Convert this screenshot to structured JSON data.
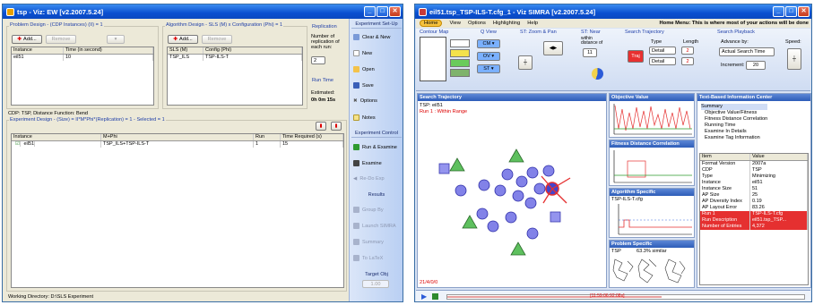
{
  "left_window": {
    "title": "tsp - Viz: EW [v2.2007.5.24]",
    "problem_design": {
      "title": "Problem Design - (CDP Instances) (II) = 1",
      "add_label": "Add...",
      "remove_label": "Remove",
      "columns": [
        "Instance",
        "Time (in second)"
      ],
      "rows": [
        [
          "eil51",
          "10"
        ]
      ],
      "cdp_text": "CDP: TSP, Distance Function: Bend"
    },
    "algorithm_design": {
      "title": "Algorithm Design - SLS (M) x Configuration (Phi) = 1",
      "add_label": "Add...",
      "remove_label": "Remove",
      "columns": [
        "SLS (M)",
        "Config (Phi)"
      ],
      "rows": [
        [
          "TSP_ILS",
          "TSP-ILS-T"
        ]
      ]
    },
    "replication": {
      "title": "Replication",
      "label": "Number of replication of each run:",
      "value": "2"
    },
    "run_time": {
      "title": "Run Time",
      "label": "Estimated:",
      "value": "0h 0m 15s"
    },
    "experiment_design": {
      "title": "Experiment Design - (Size) = II*M*Phi*(Replication) = 1 - Selected = 1",
      "columns": [
        "Instance",
        "M+Phi",
        "Run",
        "Time Required (s)"
      ],
      "rows": [
        [
          "eil51",
          "TSP_ILS+TSP-ILS-T",
          "1",
          "15"
        ]
      ]
    },
    "working_directory": "Working Directory:  D:\\SLS Experiment",
    "sidebar": {
      "setup_title": "Experiment Set-Up",
      "setup_items": [
        "Clear & New",
        "New",
        "Open",
        "Save",
        "Options",
        "Notes"
      ],
      "control_title": "Experiment Control",
      "control_items": [
        "Run & Examine",
        "Examine",
        "Re-Do Exp"
      ],
      "results_title": "Results",
      "results_items": [
        "Group By",
        "Launch SIMRA",
        "Summary",
        "To LaTeX"
      ],
      "target_title": "Target Obj",
      "target_value": "1.00"
    }
  },
  "right_window": {
    "title": "eil51.tsp_TSP-ILS-T.cfg_1 - Viz SIMRA [v2.2007.5.24]",
    "menu": [
      "Home",
      "View",
      "Options",
      "Highlighting",
      "Help"
    ],
    "home_menu_text": "Home Menu: This is where most of your actions will be done",
    "toolbar": {
      "contour_map": "Contour Map",
      "q_view": "Q View",
      "zoom_pan": "ST: Zoom & Pan",
      "st_near": "ST: Near",
      "near_label": "within distance of",
      "near_value": "11",
      "search_trajectory": "Search Trajectory",
      "type_label": "Type",
      "length_label": "Length",
      "type_value": "Detail",
      "length_value": "2",
      "search_playback": "Search Playback",
      "advance_by": "Advance by:",
      "speed_label": "Speed:",
      "advance_value": "Actual Search Time",
      "increment_label": "Increment:",
      "increment_value": "20"
    },
    "search_trajectory_panel": {
      "title": "Search Trajectory",
      "tsp_label": "TSP: eil51",
      "run_label": "Run 1 : Within Range",
      "time_label": "21/4/0/0"
    },
    "objective_panel": {
      "title": "Objective Value"
    },
    "fdc_panel": {
      "title": "Fitness Distance Correlation"
    },
    "algo_panel": {
      "title": "Algorithm Specific",
      "label": "TSP-ILS-T.cfg"
    },
    "problem_panel": {
      "title": "Problem Specific",
      "label": "TSP",
      "sub": "63.3% similar"
    },
    "text_info": {
      "title": "Text-Based Information Center",
      "tree": [
        "Summary",
        "Objective Value/Fitness",
        "Fitness Distance Correlation",
        "Running Time",
        "Examine In Details",
        "Examine Tag Information"
      ],
      "columns": [
        "Item",
        "Value"
      ],
      "rows": [
        [
          "Format Version",
          "2007a"
        ],
        [
          "CDP",
          "TSP"
        ],
        [
          "Type",
          "Minimizing"
        ],
        [
          "Instance",
          "eil51"
        ],
        [
          "Instance Size",
          "51"
        ],
        [
          "AP Size",
          "25"
        ],
        [
          "AP Diversity Index",
          "0.19"
        ],
        [
          "AP Layout Error",
          "83.26"
        ],
        [
          "Run 1",
          "TSP-ILS-T.cfg"
        ],
        [
          "Run Description",
          "eil51.tsp_TSP..."
        ],
        [
          "Number of Entries",
          "4,372"
        ]
      ]
    },
    "playback_label": "[11:59:06:92:08s]",
    "colors": {
      "highlight": "#e53030",
      "node": "#6a6ae0",
      "triangle": "#5ec05e"
    }
  }
}
